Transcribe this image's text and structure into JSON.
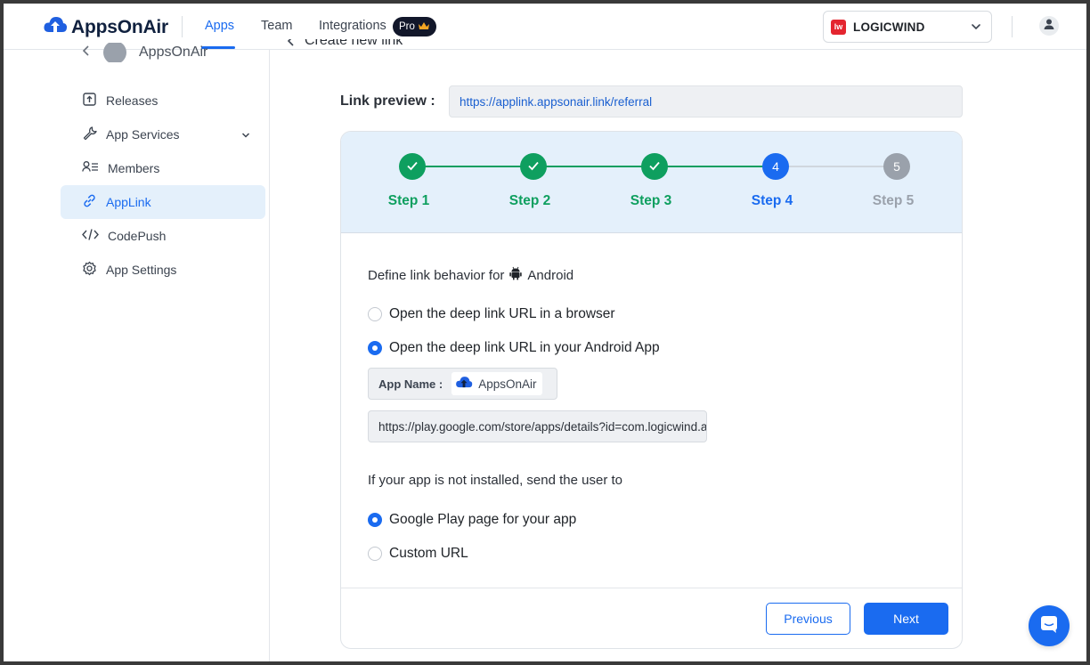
{
  "brand": {
    "name": "AppsOnAir"
  },
  "nav": {
    "apps": "Apps",
    "team": "Team",
    "integrations": "Integrations",
    "pro_badge": "Pro"
  },
  "org": {
    "name": "LOGICWIND",
    "logo_text": "lw"
  },
  "sidebar": {
    "app_name": "AppsOnAir",
    "items": [
      {
        "label": "Releases",
        "icon": "upload-box-icon"
      },
      {
        "label": "App Services",
        "icon": "wrench-icon"
      },
      {
        "label": "Members",
        "icon": "members-icon"
      },
      {
        "label": "AppLink",
        "icon": "link-icon",
        "active": true
      },
      {
        "label": "CodePush",
        "icon": "code-icon"
      },
      {
        "label": "App Settings",
        "icon": "gear-icon"
      }
    ]
  },
  "page": {
    "back_title": "Create new link",
    "link_preview_label": "Link preview :",
    "link_preview_value": "https://applink.appsonair.link/referral"
  },
  "stepper": {
    "current": 4,
    "steps": [
      {
        "label": "Step 1",
        "status": "done"
      },
      {
        "label": "Step 2",
        "status": "done"
      },
      {
        "label": "Step 3",
        "status": "done"
      },
      {
        "label": "Step 4",
        "status": "current",
        "number": "4"
      },
      {
        "label": "Step 5",
        "status": "pending",
        "number": "5"
      }
    ]
  },
  "form": {
    "behavior_title": "Define link behavior for",
    "platform": "Android",
    "option_browser": "Open the deep link URL in a browser",
    "option_app": "Open the deep link URL in your Android App",
    "selected_behavior": "app",
    "app_name_label": "App Name :",
    "app_name_value": "AppsOnAir",
    "store_url": "https://play.google.com/store/apps/details?id=com.logicwind.appsonair",
    "fallback_title": "If your app is not installed, send the user to",
    "fallback_play": "Google Play page for your app",
    "fallback_custom": "Custom URL",
    "selected_fallback": "play"
  },
  "buttons": {
    "previous": "Previous",
    "next": "Next"
  },
  "colors": {
    "accent": "#1a6bf0",
    "done": "#0e9f5f",
    "pending": "#9aa1ab",
    "stepper_bg": "#e4f0fb"
  }
}
